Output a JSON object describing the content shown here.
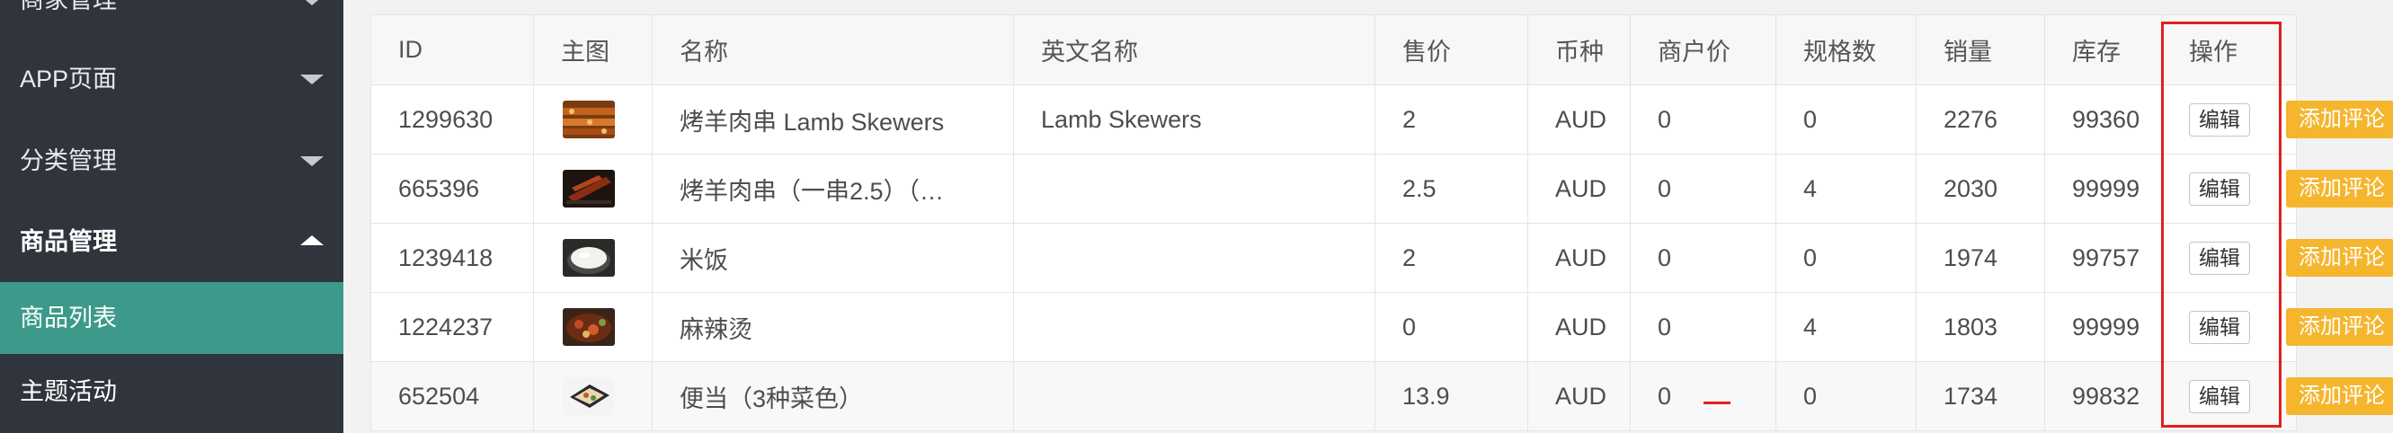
{
  "sidebar": {
    "items": [
      {
        "label": "商家管理",
        "kind": "group",
        "expanded": false
      },
      {
        "label": "APP页面",
        "kind": "group",
        "expanded": false
      },
      {
        "label": "分类管理",
        "kind": "group",
        "expanded": false
      },
      {
        "label": "商品管理",
        "kind": "group",
        "expanded": true
      },
      {
        "label": "商品列表",
        "kind": "sub",
        "active": true
      },
      {
        "label": "主题活动",
        "kind": "sub",
        "active": false
      }
    ]
  },
  "table": {
    "headers": [
      "ID",
      "主图",
      "名称",
      "英文名称",
      "售价",
      "币种",
      "商户价",
      "规格数",
      "销量",
      "库存",
      "操作"
    ],
    "rows": [
      {
        "id": "1299630",
        "thumb": "lamb-skewers",
        "name": "烤羊肉串 Lamb Skewers",
        "name_en": "Lamb Skewers",
        "price": "2",
        "currency": "AUD",
        "merchant_price": "0",
        "spec_count": "0",
        "sales": "2276",
        "stock": "99360"
      },
      {
        "id": "665396",
        "thumb": "grilled-skewers",
        "name": "烤羊肉串（一串2.5）（…",
        "name_en": "",
        "price": "2.5",
        "currency": "AUD",
        "merchant_price": "0",
        "spec_count": "4",
        "sales": "2030",
        "stock": "99999"
      },
      {
        "id": "1239418",
        "thumb": "rice-bowl",
        "name": "米饭",
        "name_en": "",
        "price": "2",
        "currency": "AUD",
        "merchant_price": "0",
        "spec_count": "0",
        "sales": "1974",
        "stock": "99757"
      },
      {
        "id": "1224237",
        "thumb": "mala-tang",
        "name": "麻辣烫",
        "name_en": "",
        "price": "0",
        "currency": "AUD",
        "merchant_price": "0",
        "spec_count": "4",
        "sales": "1803",
        "stock": "99999"
      },
      {
        "id": "652504",
        "thumb": "bento-box",
        "name": "便当（3种菜色）",
        "name_en": "",
        "price": "13.9",
        "currency": "AUD",
        "merchant_price": "0",
        "spec_count": "0",
        "sales": "1734",
        "stock": "99832"
      }
    ],
    "actions": {
      "edit_label": "编辑",
      "comment_label": "添加评论"
    }
  },
  "colors": {
    "sidebar_bg": "#2f343d",
    "active_item": "#3d9a8a",
    "comment_button": "#f5b62e",
    "highlight": "#e02020"
  }
}
